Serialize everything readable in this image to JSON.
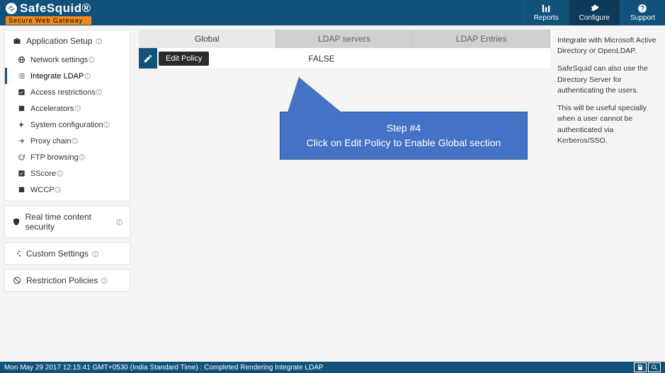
{
  "brand": {
    "name": "SafeSquid®",
    "sub": "Secure Web Gateway"
  },
  "topbar": {
    "reports": "Reports",
    "configure": "Configure",
    "support": "Support"
  },
  "sidebar": {
    "sections": [
      {
        "label": "Application Setup",
        "items": [
          {
            "label": "Network settings",
            "icon": "network"
          },
          {
            "label": "Integrate LDAP",
            "icon": "list",
            "active": true
          },
          {
            "label": "Access restrictions",
            "icon": "check"
          },
          {
            "label": "Accelerators",
            "icon": "square"
          },
          {
            "label": "System configuration",
            "icon": "bolt"
          },
          {
            "label": "Proxy chain",
            "icon": "arrow"
          },
          {
            "label": "FTP browsing",
            "icon": "refresh"
          },
          {
            "label": "SScore",
            "icon": "check"
          },
          {
            "label": "WCCP",
            "icon": "square"
          }
        ]
      },
      {
        "label": "Real time content security"
      },
      {
        "label": "Custom Settings"
      },
      {
        "label": "Restriction Policies"
      }
    ]
  },
  "tabs": [
    {
      "label": "Global",
      "active": true
    },
    {
      "label": "LDAP servers"
    },
    {
      "label": "LDAP Entries"
    }
  ],
  "row": {
    "action_label": "Edit Policy",
    "value": "FALSE"
  },
  "right": {
    "p1": "Integrate with Microsoft Active Directory or OpenLDAP.",
    "p2": "SafeSquid can also use the Directory Server for authenticating the users.",
    "p3": "This will be useful specially when a user cannot be authenticated via Kerberos/SSO."
  },
  "callout": {
    "title": "Step #4",
    "body": "Click on Edit Policy to Enable Global section"
  },
  "status": {
    "text": "Mon May 29 2017 12:15:41 GMT+0530 (India Standard Time) : Completed Rendering Integrate LDAP"
  }
}
